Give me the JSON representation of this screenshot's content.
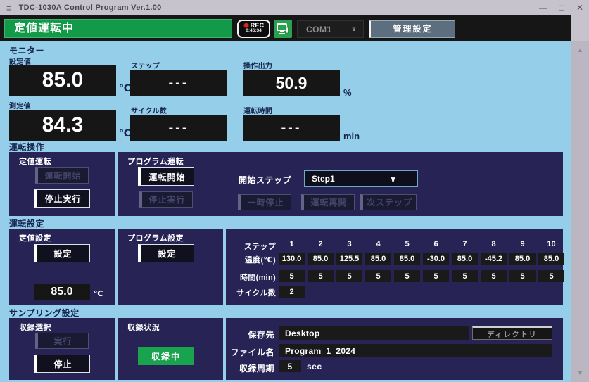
{
  "window": {
    "title": "TDC-1030A Control Program Ver.1.00"
  },
  "icons": {
    "menu": "≡",
    "minimize": "—",
    "maximize": "□",
    "close": "✕",
    "chevron_down": "∨",
    "scroll_up": "▲",
    "scroll_down": "▼"
  },
  "header": {
    "status": "定値運転中",
    "rec_label": "REC",
    "rec_time": "0:46:34",
    "com_port": "COM1",
    "admin_button": "管理設定"
  },
  "monitor": {
    "title": "モニター",
    "sv": {
      "label": "設定値",
      "value": "85.0",
      "unit": "℃"
    },
    "step": {
      "label": "ステップ",
      "value": "---"
    },
    "output": {
      "label": "操作出力",
      "value": "50.9",
      "unit": "%"
    },
    "pv": {
      "label": "測定値",
      "value": "84.3",
      "unit": "℃"
    },
    "cycle": {
      "label": "サイクル数",
      "value": "---"
    },
    "runtime": {
      "label": "運転時間",
      "value": "---",
      "unit": "min"
    }
  },
  "operation": {
    "title": "運転操作",
    "fixed": {
      "label": "定値運転",
      "start": "運転開始",
      "stop": "停止実行"
    },
    "program": {
      "label": "プログラム運転",
      "start": "運転開始",
      "stop": "停止実行"
    },
    "start_step": {
      "label": "開始ステップ",
      "value": "Step1"
    },
    "pause": "一時停止",
    "resume": "運転再開",
    "next": "次ステップ"
  },
  "settings": {
    "title": "運転設定",
    "fixed": {
      "label": "定値設定",
      "set": "設定",
      "value": "85.0",
      "unit": "℃"
    },
    "program": {
      "label": "プログラム設定",
      "set": "設定"
    },
    "table": {
      "step_label": "ステップ",
      "temp_label": "温度(℃)",
      "time_label": "時間(min)",
      "cycle_label": "サイクル数",
      "steps": [
        "1",
        "2",
        "3",
        "4",
        "5",
        "6",
        "7",
        "8",
        "9",
        "10"
      ],
      "temps": [
        "130.0",
        "85.0",
        "125.5",
        "85.0",
        "85.0",
        "-30.0",
        "85.0",
        "-45.2",
        "85.0",
        "85.0"
      ],
      "times": [
        "5",
        "5",
        "5",
        "5",
        "5",
        "5",
        "5",
        "5",
        "5",
        "5"
      ],
      "cycle_value": "2"
    }
  },
  "sampling": {
    "title": "サンプリング設定",
    "select": {
      "label": "収録選択",
      "run": "実行",
      "stop": "停止"
    },
    "status": {
      "label": "収録状況",
      "badge": "収録中"
    },
    "dest": {
      "label": "保存先",
      "value": "Desktop",
      "dir_button": "ディレクトリ"
    },
    "file": {
      "label": "ファイル名",
      "value": "Program_1_2024"
    },
    "period": {
      "label": "収録周期",
      "value": "5",
      "unit": "sec"
    }
  },
  "colors": {
    "accent_green": "#129a48",
    "rec_red": "#d22b22",
    "panel_navy": "#272355",
    "bg_blue": "#95cee8"
  }
}
